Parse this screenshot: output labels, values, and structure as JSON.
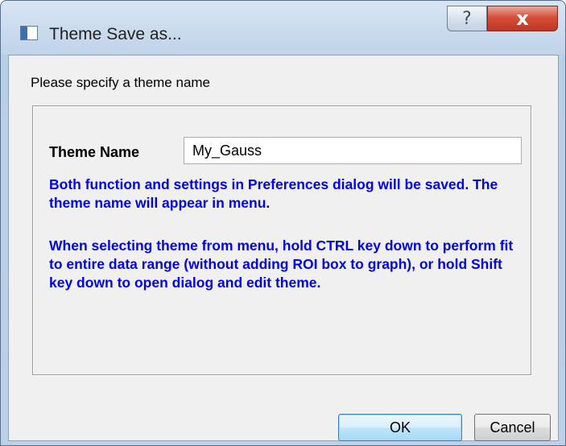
{
  "window": {
    "title": "Theme Save as...",
    "help_glyph": "?",
    "close_glyph": "x"
  },
  "dialog": {
    "instruction": "Please specify a theme name",
    "theme_name_label": "Theme Name",
    "theme_name_value": "My_Gauss",
    "info_1": "Both function and settings in Preferences dialog will be saved. The theme name will appear in menu.",
    "info_2": "When selecting theme from menu, hold CTRL key down to perform fit to entire data range (without adding ROI box to graph), or hold Shift key down to open dialog and edit theme."
  },
  "buttons": {
    "ok_label": "OK",
    "cancel_label": "Cancel"
  },
  "colors": {
    "info_text": "#0000ee",
    "close_button": "#c2351f"
  },
  "icons": {
    "app": "window-icon",
    "help": "help-icon",
    "close": "close-icon"
  }
}
